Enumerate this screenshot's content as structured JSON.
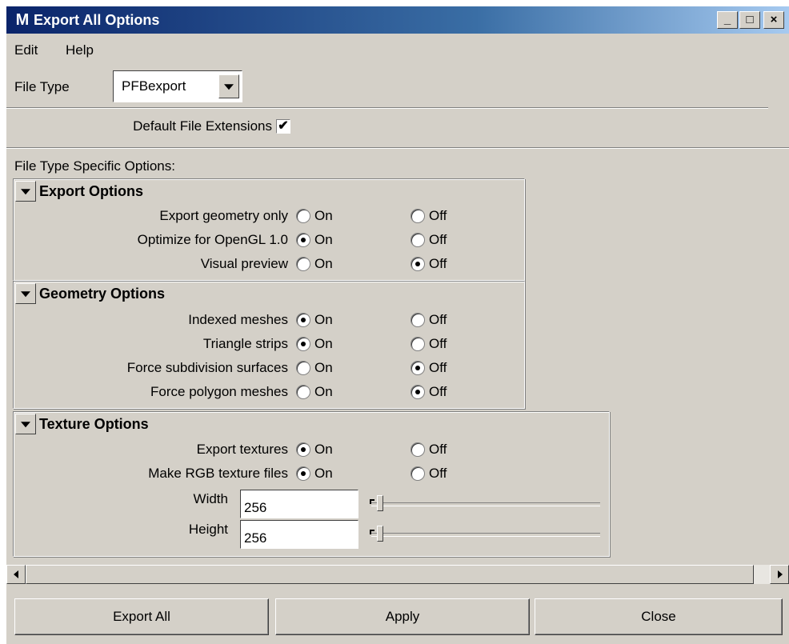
{
  "window": {
    "title": "Export All Options",
    "icon": "maya-icon",
    "min": "_",
    "max": "□",
    "close": "×"
  },
  "menu": {
    "edit": "Edit",
    "help": "Help"
  },
  "file_type": {
    "label": "File Type",
    "value": "PFBexport"
  },
  "default_ext": {
    "label": "Default File Extensions",
    "checked": true,
    "mark": "✔"
  },
  "specific_label": "File Type Specific Options:",
  "export_options": {
    "title": "Export Options",
    "rows": [
      {
        "label": "Export geometry only",
        "on": "On",
        "off": "Off",
        "selected": "none"
      },
      {
        "label": "Optimize for OpenGL 1.0",
        "on": "On",
        "off": "Off",
        "selected": "on"
      },
      {
        "label": "Visual preview",
        "on": "On",
        "off": "Off",
        "selected": "off"
      }
    ]
  },
  "geometry_options": {
    "title": "Geometry Options",
    "rows": [
      {
        "label": "Indexed meshes",
        "on": "On",
        "off": "Off",
        "selected": "on"
      },
      {
        "label": "Triangle strips",
        "on": "On",
        "off": "Off",
        "selected": "on"
      },
      {
        "label": "Force subdivision surfaces",
        "on": "On",
        "off": "Off",
        "selected": "off"
      },
      {
        "label": "Force polygon meshes",
        "on": "On",
        "off": "Off",
        "selected": "off"
      }
    ]
  },
  "texture_options": {
    "title": "Texture Options",
    "rows": [
      {
        "label": "Export textures",
        "on": "On",
        "off": "Off",
        "selected": "on"
      },
      {
        "label": "Make RGB texture files",
        "on": "On",
        "off": "Off",
        "selected": "on"
      }
    ],
    "width": {
      "label": "Width",
      "value": "256"
    },
    "height": {
      "label": "Height",
      "value": "256"
    }
  },
  "buttons": {
    "export_all": "Export All",
    "apply": "Apply",
    "close": "Close"
  }
}
